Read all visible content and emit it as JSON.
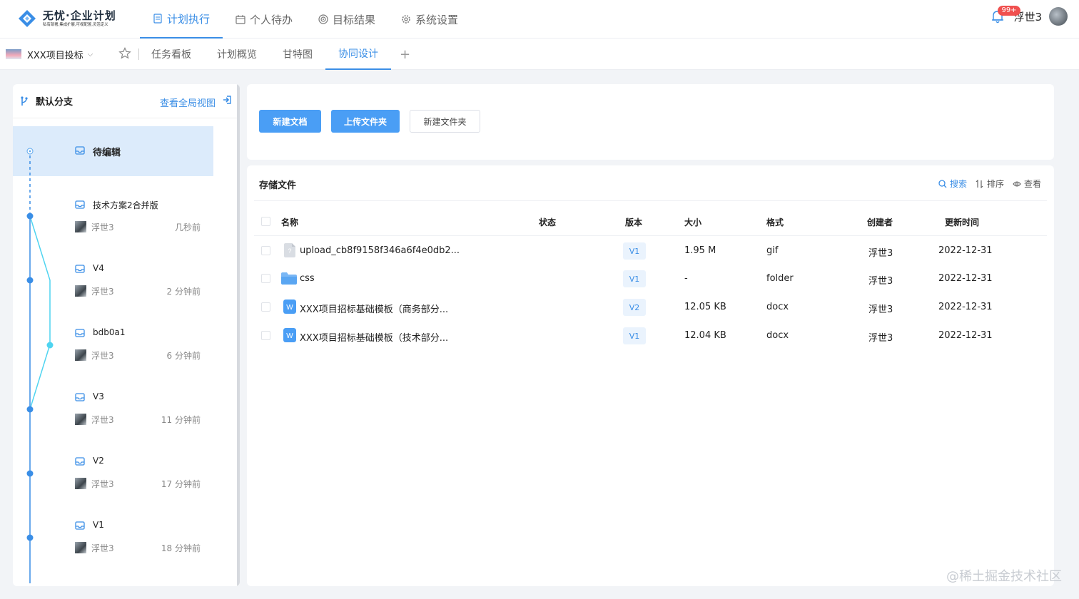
{
  "app": {
    "title": "无忧·企业计划",
    "subtitle": "私有部署,集成扩展,可视配置,灵活定义"
  },
  "top_nav": [
    {
      "label": "计划执行",
      "icon": "document-icon",
      "active": true
    },
    {
      "label": "个人待办",
      "icon": "calendar-icon",
      "active": false
    },
    {
      "label": "目标结果",
      "icon": "target-icon",
      "active": false
    },
    {
      "label": "系统设置",
      "icon": "gear-icon",
      "active": false
    }
  ],
  "user": {
    "name": "浮世3",
    "notifications": "99+"
  },
  "project": {
    "name": "XXX项目投标"
  },
  "sub_tabs": [
    {
      "label": "任务看板",
      "active": false
    },
    {
      "label": "计划概览",
      "active": false
    },
    {
      "label": "甘特图",
      "active": false
    },
    {
      "label": "协同设计",
      "active": true
    },
    {
      "label": "+",
      "active": false
    }
  ],
  "branch": {
    "name": "默认分支",
    "view_all": "查看全局视图",
    "pending": "待编辑",
    "commits": [
      {
        "title": "技术方案2合并版",
        "user": "浮世3",
        "time": "几秒前"
      },
      {
        "title": "V4",
        "user": "浮世3",
        "time": "2 分钟前"
      },
      {
        "title": "bdb0a1",
        "user": "浮世3",
        "time": "6 分钟前"
      },
      {
        "title": "V3",
        "user": "浮世3",
        "time": "11 分钟前"
      },
      {
        "title": "V2",
        "user": "浮世3",
        "time": "17 分钟前"
      },
      {
        "title": "V1",
        "user": "浮世3",
        "time": "18 分钟前"
      }
    ]
  },
  "actions": {
    "new_doc": "新建文档",
    "upload_folder": "上传文件夹",
    "new_folder": "新建文件夹"
  },
  "files": {
    "title": "存储文件",
    "tools": {
      "search": "搜索",
      "sort": "排序",
      "view": "查看"
    },
    "columns": {
      "name": "名称",
      "status": "状态",
      "version": "版本",
      "size": "大小",
      "format": "格式",
      "creator": "创建者",
      "updated": "更新时间"
    },
    "rows": [
      {
        "name": "upload_cb8f9158f346a6f4e0db2...",
        "status": "",
        "version": "V1",
        "size": "1.95 M",
        "format": "gif",
        "creator": "浮世3",
        "updated": "2022-12-31",
        "icon": "image-file-icon"
      },
      {
        "name": "css",
        "status": "",
        "version": "V1",
        "size": "-",
        "format": "folder",
        "creator": "浮世3",
        "updated": "2022-12-31",
        "icon": "folder-icon"
      },
      {
        "name": "XXX项目招标基础模板（商务部分...",
        "status": "",
        "version": "V2",
        "size": "12.05 KB",
        "format": "docx",
        "creator": "浮世3",
        "updated": "2022-12-31",
        "icon": "word-doc-icon"
      },
      {
        "name": "XXX项目招标基础模板（技术部分...",
        "status": "",
        "version": "V1",
        "size": "12.04 KB",
        "format": "docx",
        "creator": "浮世3",
        "updated": "2022-12-31",
        "icon": "word-doc-icon"
      }
    ]
  },
  "watermark": "@稀土掘金技术社区",
  "colors": {
    "accent": "#3a8ee6",
    "button": "#4a9ef5",
    "timeline": "#4fd4f0",
    "badge": "#f0504f"
  }
}
